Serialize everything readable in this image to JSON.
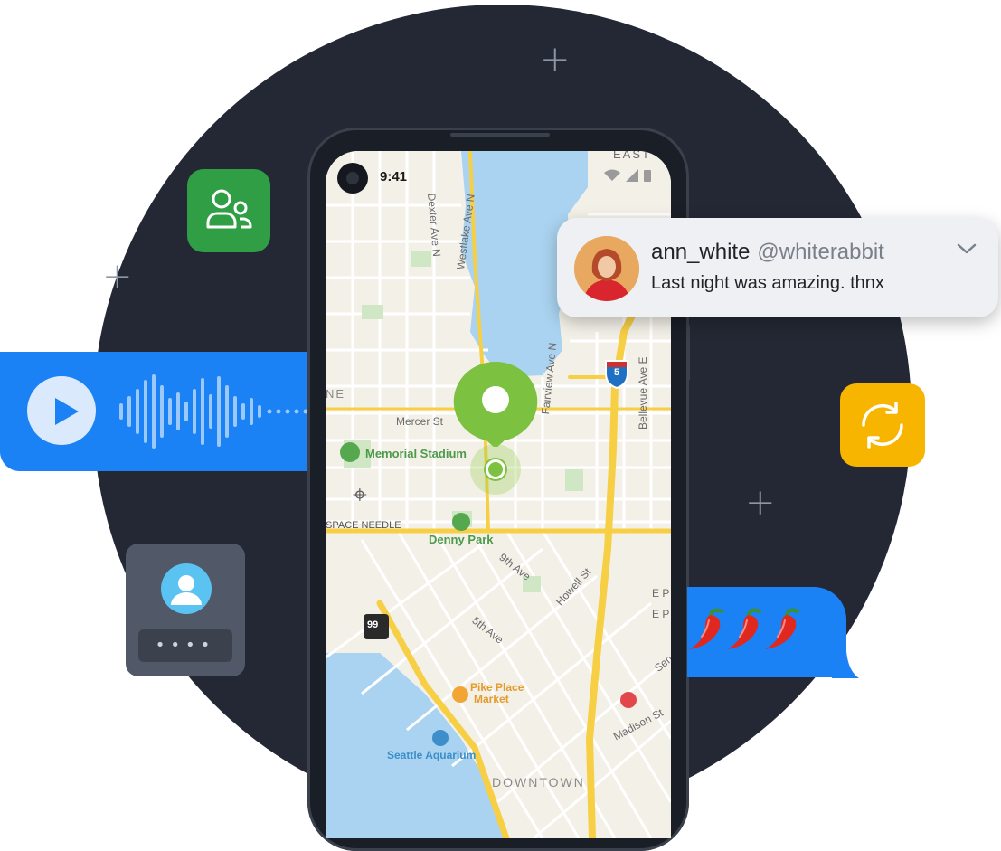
{
  "phone": {
    "status_time": "9:41"
  },
  "map": {
    "labels": {
      "east": "EAST",
      "dexter": "Dexter Ave N",
      "westlake": "Westlake Ave N",
      "fairview": "Fairview Ave N",
      "bellevue": "Bellevue Ave E",
      "mercer": "Mercer St",
      "memorial_stadium": "Memorial Stadium",
      "space_needle": "SPACE NEEDLE",
      "denny_park": "Denny Park",
      "ninth": "9th Ave",
      "howell": "Howell St",
      "fifth": "5th Ave",
      "pike_place_1": "Pike Place",
      "pike_place_2": "Market",
      "seattle_aquarium": "Seattle Aquarium",
      "downtown": "DOWNTOWN",
      "madison": "Madison St",
      "ne": "NE",
      "highway_5": "5",
      "highway_99": "99",
      "sen": "Sen",
      "e_p1": "E P",
      "e_p2": "E P"
    }
  },
  "notification": {
    "username": "ann_white",
    "handle": "@whiterabbit",
    "message": "Last night was amazing. thnx"
  },
  "contact": {
    "pin_mask": "••••"
  },
  "chat": {
    "emoji_count": 3
  },
  "colors": {
    "background_circle": "#232834",
    "voice_blue": "#1a82f5",
    "tile_green": "#2f9e44",
    "tile_yellow": "#f7b500",
    "pin_green": "#7cc140"
  },
  "icons": {
    "green_tile": "people-icon",
    "yellow_tile": "sync-icon",
    "voice": "play-icon",
    "chat": "chili-pepper-icon"
  }
}
